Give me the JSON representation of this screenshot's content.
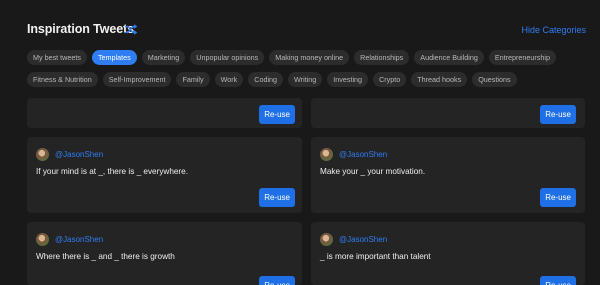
{
  "header": {
    "title": "Inspiration Tweets",
    "shuffle_icon": "shuffle-icon",
    "hide_label": "Hide Categories",
    "accent": "#2f7df3"
  },
  "categories": {
    "row1": [
      "My best tweets",
      "Templates",
      "Marketing",
      "Unpopular opinions",
      "Making money online",
      "Relationships",
      "Audience Building",
      "Entrepreneurship"
    ],
    "row2": [
      "Fitness & Nutrition",
      "Self-Improvement",
      "Family",
      "Work",
      "Coding",
      "Writing",
      "Investing",
      "Crypto",
      "Thread hooks",
      "Questions"
    ],
    "active": "Templates"
  },
  "cards": [
    {
      "user": "",
      "text": "",
      "button": "Re-use"
    },
    {
      "user": "",
      "text": "",
      "button": "Re-use"
    },
    {
      "user": "@JasonShen",
      "text": "If your mind is at _, there is _ everywhere.",
      "button": "Re-use"
    },
    {
      "user": "@JasonShen",
      "text": "Make your _ your motivation.",
      "button": "Re-use"
    },
    {
      "user": "@JasonShen",
      "text": "Where there is _ and _ there is growth",
      "button": "Re-use"
    },
    {
      "user": "@JasonShen",
      "text": "_ is more important than talent",
      "button": "Re-use"
    }
  ]
}
